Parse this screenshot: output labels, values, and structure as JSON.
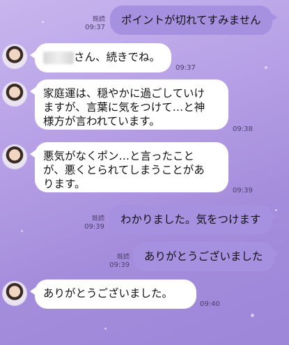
{
  "messages": [
    {
      "dir": "out",
      "text": "ポイントが切れてすみません",
      "read": "既読",
      "time": "09:37"
    },
    {
      "dir": "in",
      "text": "さん、続きでね。",
      "time": "09:37"
    },
    {
      "dir": "in",
      "lines": [
        "家庭運は、穏やかに過ごしていけ",
        "ますが、言葉に気をつけて…と神",
        "様方が言われています。"
      ],
      "time": "09:38"
    },
    {
      "dir": "in",
      "lines": [
        "悪気がなくポン…と言ったこと",
        "が、悪くとられてしまうことがあ",
        "ります。"
      ],
      "time": "09:39"
    },
    {
      "dir": "out",
      "text": "わかりました。気をつけます",
      "read": "既読",
      "time": "09:39"
    },
    {
      "dir": "out",
      "text": "ありがとうございました",
      "read": "既読",
      "time": "09:39"
    },
    {
      "dir": "in",
      "text": "ありがとうございました。",
      "time": "09:40"
    }
  ]
}
